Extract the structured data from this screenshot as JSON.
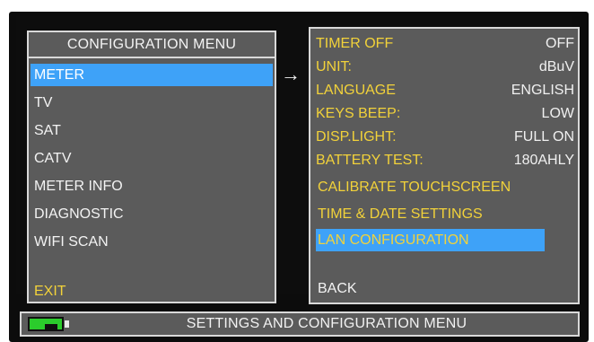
{
  "left_menu": {
    "title": "CONFIGURATION MENU",
    "items": [
      {
        "label": "METER",
        "selected": true
      },
      {
        "label": "TV",
        "selected": false
      },
      {
        "label": "SAT",
        "selected": false
      },
      {
        "label": "CATV",
        "selected": false
      },
      {
        "label": "METER INFO",
        "selected": false
      },
      {
        "label": "DIAGNOSTIC",
        "selected": false
      },
      {
        "label": "WIFI SCAN",
        "selected": false
      }
    ],
    "exit_label": "EXIT"
  },
  "submenu_arrow": "→",
  "right_menu": {
    "settings": [
      {
        "label": "TIMER OFF",
        "value": "OFF"
      },
      {
        "label": "UNIT:",
        "value": "dBuV"
      },
      {
        "label": "LANGUAGE",
        "value": "ENGLISH"
      },
      {
        "label": "KEYS BEEP:",
        "value": "LOW"
      },
      {
        "label": "DISP.LIGHT:",
        "value": "FULL ON"
      },
      {
        "label": "BATTERY TEST:",
        "value": "180AHLY"
      }
    ],
    "actions": [
      {
        "label": "CALIBRATE TOUCHSCREEN",
        "selected": false
      },
      {
        "label": "TIME & DATE SETTINGS",
        "selected": false
      },
      {
        "label": "LAN CONFIGURATION",
        "selected": true
      }
    ],
    "back_label": "BACK"
  },
  "status_bar": {
    "battery_icon": "battery-icon",
    "text": "SETTINGS AND CONFIGURATION MENU"
  },
  "colors": {
    "panel_bg": "#5b5b5b",
    "selection": "#3ea2f8",
    "accent_yellow": "#f2d23a",
    "battery_green": "#2bcc2c"
  }
}
